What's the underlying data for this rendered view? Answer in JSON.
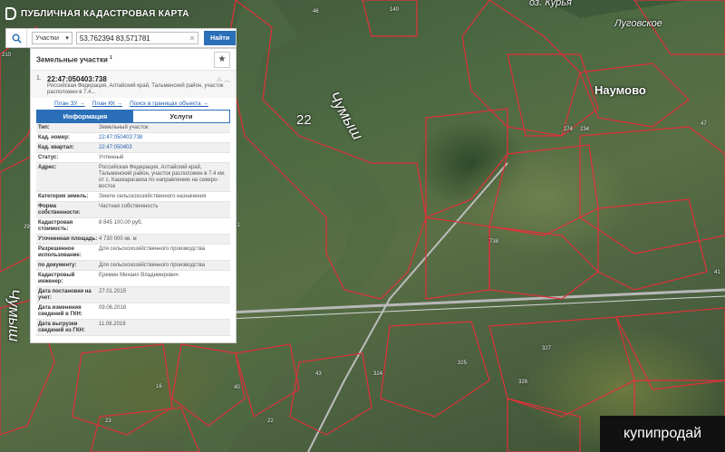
{
  "header": {
    "app_title": "ПУБЛИЧНАЯ КАДАСТРОВАЯ КАРТА"
  },
  "search": {
    "type_label": "Участки",
    "query": "53,762394 83,571781",
    "find_label": "Найти"
  },
  "panel": {
    "title": "Земельные участки",
    "title_sup": "1",
    "result": {
      "index": "1.",
      "cad_number": "22:47:050403:738",
      "address": "Российская Федерация, Алтайский край, Тальменский район, участок расположен в 7.4...",
      "links": [
        "План ЗУ →",
        "План КК →",
        "Поиск в границах объекта →"
      ]
    },
    "tabs": [
      "Информация",
      "Услуги"
    ],
    "properties": [
      {
        "key": "Тип:",
        "value": "Земельный участок"
      },
      {
        "key": "Кад. номер:",
        "value": "22:47:050403:738"
      },
      {
        "key": "Кад. квартал:",
        "value": "22:47:050403"
      },
      {
        "key": "Статус:",
        "value": "Учтенный"
      },
      {
        "key": "Адрес:",
        "value": "Российская Федерация, Алтайский край, Тальменский район, участок расположен в 7.4 км. от с. Кашкарагаиха по направлению на северо-восток"
      },
      {
        "key": "Категория земель:",
        "value": "Земли сельскохозяйственного назначения"
      },
      {
        "key": "Форма собственности:",
        "value": "Частная собственность"
      },
      {
        "key": "Кадастровая стоимость:",
        "value": "8 845 100,00 руб."
      },
      {
        "key": "Уточненная площадь:",
        "value": "4 730 000 кв. м"
      },
      {
        "key": "Разрешенное использование:",
        "value": "Для сельскохозяйственного производства"
      },
      {
        "key": "по документу:",
        "value": "Для сельскохозяйственного производства"
      },
      {
        "key": "Кадастровый инженер:",
        "value": "Еремин Михаил Владимирович"
      },
      {
        "key": "Дата постановки на учет:",
        "value": "27.01.2015"
      },
      {
        "key": "Дата изменения сведений в ГКН:",
        "value": "09.06.2018"
      },
      {
        "key": "Дата выгрузки сведений из ГКН:",
        "value": "11.06.2018"
      }
    ]
  },
  "map": {
    "labels": {
      "river_main": "Чумыш",
      "river_left": "Чумыш",
      "parcel_22": "22",
      "village_naumovo": "Наумово",
      "village_lugovskoe": "Луговское",
      "lake_kurya": "оз. Курья"
    },
    "numbers": [
      "46",
      "140",
      "738",
      "274",
      "234",
      "47",
      "21",
      "40",
      "22",
      "43",
      "210",
      "23",
      "325",
      "327",
      "326",
      "324",
      "29",
      "16",
      "41"
    ]
  },
  "watermark": {
    "text": "купипродай"
  }
}
